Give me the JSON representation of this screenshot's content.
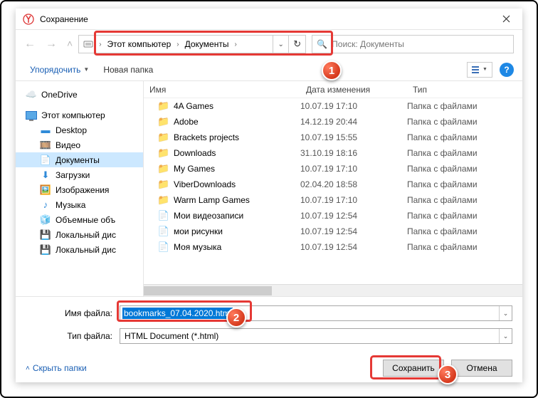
{
  "window": {
    "title": "Сохранение"
  },
  "breadcrumb": {
    "root": "Этот компьютер",
    "current": "Документы"
  },
  "search": {
    "placeholder": "Поиск: Документы"
  },
  "toolbar": {
    "organize": "Упорядочить",
    "newfolder": "Новая папка"
  },
  "columns": {
    "name": "Имя",
    "date": "Дата изменения",
    "type": "Тип"
  },
  "nav": {
    "onedrive": "OneDrive",
    "thispc": "Этот компьютер",
    "desktop": "Desktop",
    "video": "Видео",
    "documents": "Документы",
    "downloads": "Загрузки",
    "pictures": "Изображения",
    "music": "Музыка",
    "volumes": "Объемные объ",
    "localdisk1": "Локальный дис",
    "localdisk2": "Локальный дис"
  },
  "files": [
    {
      "name": "4A Games",
      "date": "10.07.19 17:10",
      "type": "Папка с файлами",
      "icon": "folder"
    },
    {
      "name": "Adobe",
      "date": "14.12.19 20:44",
      "type": "Папка с файлами",
      "icon": "folder"
    },
    {
      "name": "Brackets projects",
      "date": "10.07.19 15:55",
      "type": "Папка с файлами",
      "icon": "folder"
    },
    {
      "name": "Downloads",
      "date": "31.10.19 18:16",
      "type": "Папка с файлами",
      "icon": "folder"
    },
    {
      "name": "My Games",
      "date": "10.07.19 17:10",
      "type": "Папка с файлами",
      "icon": "folder"
    },
    {
      "name": "ViberDownloads",
      "date": "02.04.20 18:58",
      "type": "Папка с файлами",
      "icon": "folder"
    },
    {
      "name": "Warm Lamp Games",
      "date": "10.07.19 17:10",
      "type": "Папка с файлами",
      "icon": "folder"
    },
    {
      "name": "Мои видеозаписи",
      "date": "10.07.19 12:54",
      "type": "Папка с файлами",
      "icon": "shortcut"
    },
    {
      "name": "мои рисунки",
      "date": "10.07.19 12:54",
      "type": "Папка с файлами",
      "icon": "shortcut"
    },
    {
      "name": "Моя музыка",
      "date": "10.07.19 12:54",
      "type": "Папка с файлами",
      "icon": "shortcut"
    }
  ],
  "form": {
    "filename_label": "Имя файла:",
    "filename_value": "bookmarks_07.04.2020.html",
    "filetype_label": "Тип файла:",
    "filetype_value": "HTML Document (*.html)"
  },
  "footer": {
    "hidefolders": "Скрыть папки",
    "save": "Сохранить",
    "cancel": "Отмена"
  },
  "callouts": {
    "one": "1",
    "two": "2",
    "three": "3"
  }
}
